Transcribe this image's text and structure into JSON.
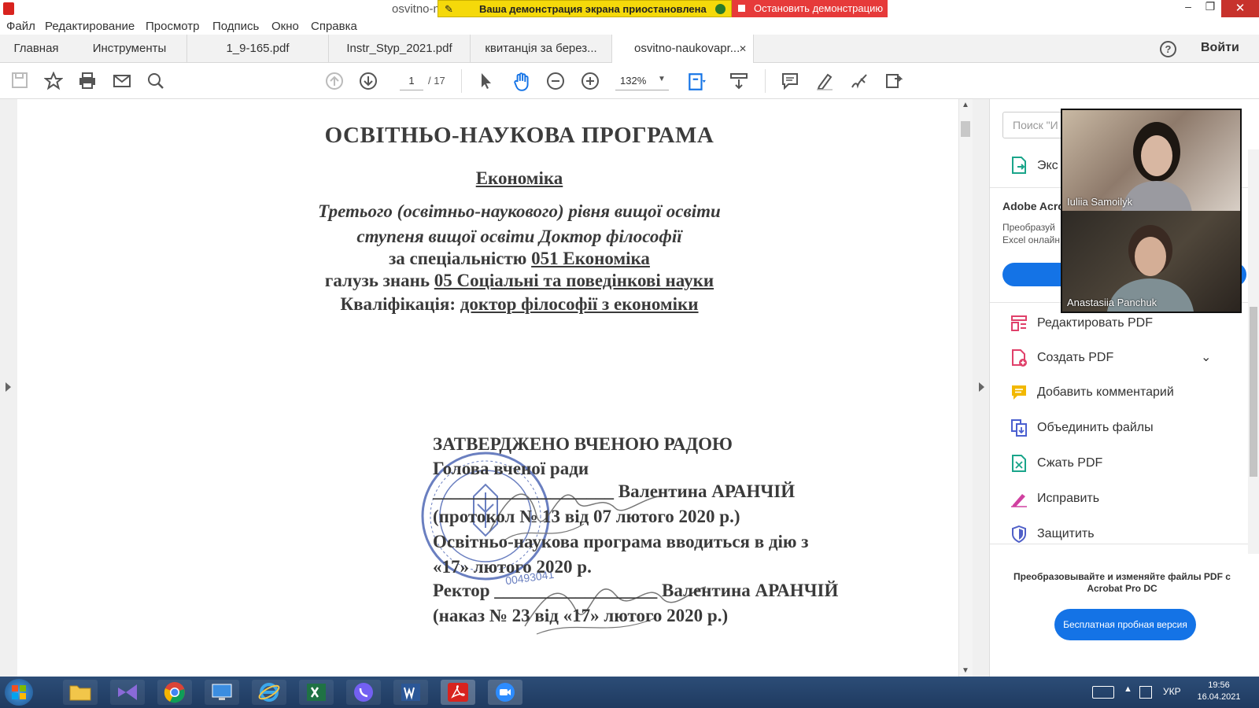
{
  "window": {
    "title": "osvitno-n",
    "share_banner": "Ваша демонстрация экрана приостановлена",
    "stop_share": "Остановить демонстрацию",
    "minimize": "‒",
    "restore": "❐",
    "close": "✕"
  },
  "menu": [
    "Файл",
    "Редактирование",
    "Просмотр",
    "Подпись",
    "Окно",
    "Справка"
  ],
  "tabs": [
    {
      "label": "Главная"
    },
    {
      "label": "Инструменты"
    },
    {
      "label": "1_9-165.pdf"
    },
    {
      "label": "Instr_Styp_2021.pdf"
    },
    {
      "label": "квитанція за берез..."
    },
    {
      "label": "osvitno-naukovapr...",
      "close": "✕"
    }
  ],
  "header": {
    "help": "?",
    "login": "Войти"
  },
  "toolbar": {
    "page_current": "1",
    "page_total": "/ 17",
    "zoom": "132%"
  },
  "document": {
    "title": "ОСВІТНЬО-НАУКОВА ПРОГРАМА",
    "subject": "Економіка",
    "level_line1": "Третього (освітньо-наукового) рівня вищої освіти",
    "level_line2": "ступеня вищої освіти Доктор філософії",
    "specialty_prefix": "за спеціальністю",
    "specialty": "051 Економіка",
    "field_prefix": "галузь знань",
    "field": "05 Соціальні та поведінкові науки",
    "qual_prefix": "Кваліфікація:",
    "qual": "доктор філософії з економіки",
    "approved": "ЗАТВЕРДЖЕНО ВЧЕНОЮ РАДОЮ",
    "council_head": "Голова вченої ради",
    "head_blank": "____________________",
    "head_name": "Валентина АРАНЧІЙ",
    "protocol": "(протокол № 13 від 07 лютого 2020 р.)",
    "effective_line1": "Освітньо-наукова програма вводиться в дію з",
    "effective_line2": "«17» лютого 2020 р.",
    "rector": "Ректор",
    "rector_blank": "__________________",
    "rector_name": "Валентина АРАНЧІЙ",
    "order": "(наказ № 23 від «17» лютого 2020 р.)",
    "stamp_number": "00493041"
  },
  "right_panel": {
    "search_placeholder": "Поиск \"И",
    "export_label": "Экс",
    "promo_title": "Adobe Acro",
    "promo_text1": "Преобразуй",
    "promo_text2": "Excel онлайн",
    "tools": [
      {
        "label": "Редактировать PDF",
        "icon": "edit-pdf-icon",
        "color": "#e0406a"
      },
      {
        "label": "Создать PDF",
        "icon": "create-pdf-icon",
        "color": "#e0406a"
      },
      {
        "label": "Добавить комментарий",
        "icon": "comment-icon",
        "color": "#f2b800"
      },
      {
        "label": "Объединить файлы",
        "icon": "combine-icon",
        "color": "#4a5fd0"
      },
      {
        "label": "Сжать PDF",
        "icon": "compress-icon",
        "color": "#1aa58a"
      },
      {
        "label": "Исправить",
        "icon": "fix-icon",
        "color": "#d040a0"
      },
      {
        "label": "Защитить",
        "icon": "protect-icon",
        "color": "#5060c8"
      }
    ],
    "promo_bottom": "Преобразовывайте и изменяйте файлы PDF с Acrobat Pro DC",
    "trial_button": "Бесплатная пробная версия"
  },
  "video": {
    "participants": [
      {
        "name": "Iuliia Samoilyk"
      },
      {
        "name": "Anastasiia Panchuk"
      }
    ]
  },
  "taskbar": {
    "lang": "УКР",
    "time": "19:56",
    "date": "16.04.2021"
  },
  "colors": {
    "accent": "#1473e6",
    "share_yellow": "#f5d90a",
    "stop_red": "#e63a3a"
  }
}
